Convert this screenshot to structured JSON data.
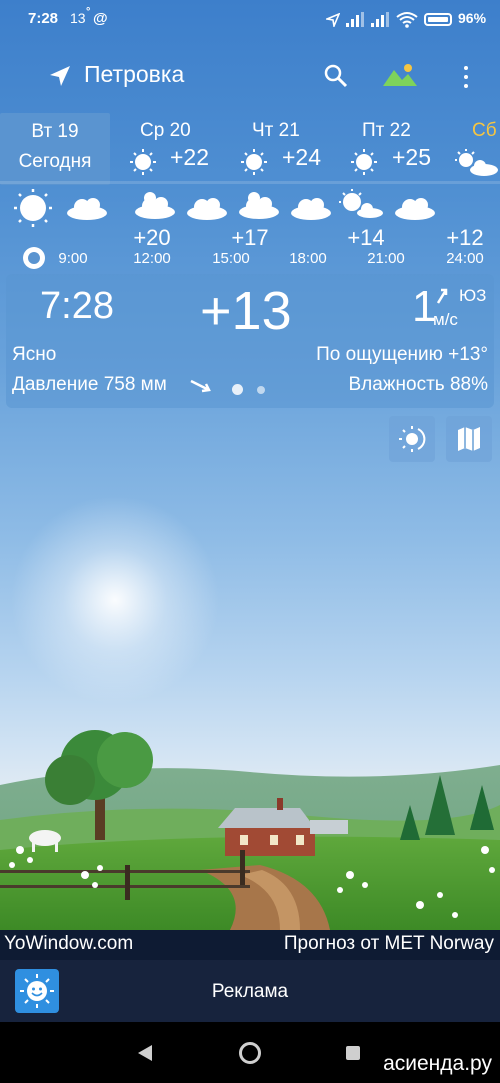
{
  "status_bar": {
    "time": "7:28",
    "temp": "13",
    "wifi": "wifi-icon",
    "battery": "96%"
  },
  "header": {
    "location": "Петровка"
  },
  "days": [
    {
      "name": "Вт 19",
      "sub": "Сегодня",
      "temp": ""
    },
    {
      "name": "Ср 20",
      "temp": "+22"
    },
    {
      "name": "Чт 21",
      "temp": "+24"
    },
    {
      "name": "Пт 22",
      "temp": "+25"
    },
    {
      "name": "Сб",
      "temp": ""
    }
  ],
  "hourly": [
    {
      "time": "9:00",
      "temp": ""
    },
    {
      "time": "12:00",
      "temp": "+20"
    },
    {
      "time": "15:00",
      "temp": "+17"
    },
    {
      "time": "18:00",
      "temp": ""
    },
    {
      "time": "21:00",
      "temp": "+14"
    },
    {
      "time": "24:00",
      "temp": "+12"
    }
  ],
  "current": {
    "time": "7:28",
    "temp": "+13",
    "wind_speed": "1",
    "wind_unit": "м/с",
    "wind_dir": "ЮЗ",
    "condition": "Ясно",
    "feels_like": "По ощущению +13°",
    "pressure": "Давление 758 мм",
    "humidity": "Влажность 88%"
  },
  "footer": {
    "left": "YoWindow.com",
    "right": "Прогноз от MET Norway"
  },
  "ad": {
    "label": "Реклама"
  },
  "watermark": "асиенда.ру",
  "colors": {
    "accent": "#f5c542",
    "card": "#5a96d2",
    "selected_tab": "#5a94d0"
  }
}
